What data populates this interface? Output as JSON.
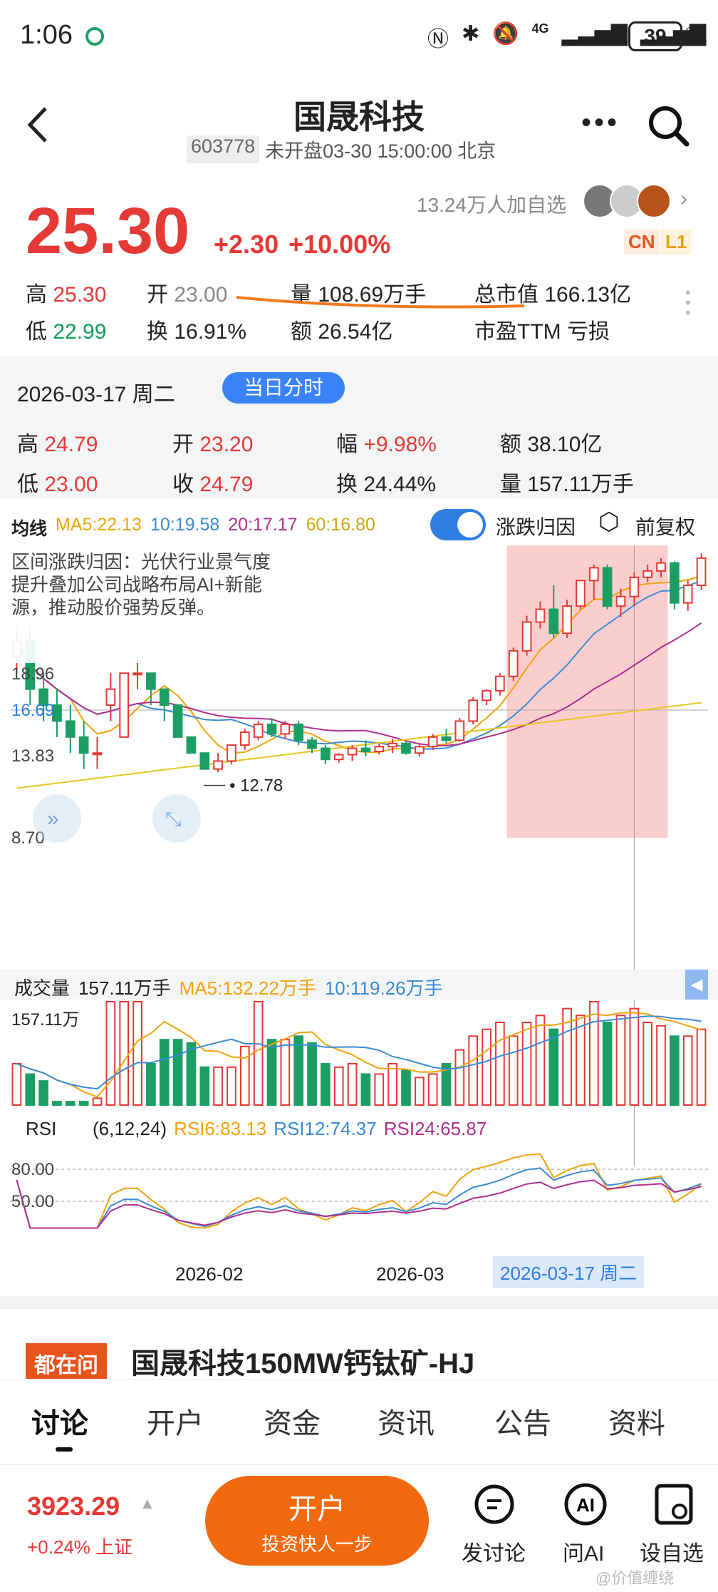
{
  "status": {
    "time": "1:06",
    "battery": "39",
    "net": "4G"
  },
  "header": {
    "title": "国晟科技",
    "code": "603778",
    "status_text": "未开盘03-30 15:00:00 北京"
  },
  "quote": {
    "price": "25.30",
    "change": "+2.30",
    "pct": "+10.00%",
    "followers": "13.24万人加自选",
    "badge_cn": "CN",
    "badge_l1": "L1",
    "high_label": "高",
    "high": "25.30",
    "open_label": "开",
    "open": "23.00",
    "vol_label": "量",
    "vol": "108.69万手",
    "mcap_label": "总市值",
    "mcap": "166.13亿",
    "low_label": "低",
    "low": "22.99",
    "turn_label": "换",
    "turn": "16.91%",
    "amt_label": "额",
    "amt": "26.54亿",
    "pe_label": "市盈TTM",
    "pe": "亏损"
  },
  "day": {
    "date": "2026-03-17 周二",
    "chip": "当日分时",
    "high_label": "高",
    "high": "24.79",
    "open_label": "开",
    "open": "23.20",
    "amp_label": "幅",
    "amp": "+9.98%",
    "amt_label": "额",
    "amt": "38.10亿",
    "low_label": "低",
    "low": "23.00",
    "close_label": "收",
    "close": "24.79",
    "turn_label": "换",
    "turn": "24.44%",
    "vol_label": "量",
    "vol": "157.11万手"
  },
  "ma": {
    "label": "均线",
    "ma5": "MA5:22.13",
    "ma10": "10:19.58",
    "ma20": "20:17.17",
    "ma60": "60:16.80",
    "toggle_label": "涨跌归因",
    "adj_label": "前复权"
  },
  "colors": {
    "up": "#e53935",
    "down": "#1b9e63",
    "ma5": "#f2a20c",
    "ma10": "#3a8bd6",
    "ma20": "#b0308f",
    "ma60": "#e8c51e",
    "accent": "#3b82f6",
    "orange": "#f26a0f"
  },
  "chart_data": {
    "type": "candlestick",
    "attribution": "区间涨跌归因：光伏行业景气度提升叠加公司战略布局AI+新能源，推动股价强势反弹。",
    "y_ticks": [
      "18.96",
      "16.69",
      "13.83",
      "8.70"
    ],
    "low_marker": "12.78",
    "x_ticks": [
      "2026-02",
      "2026-03"
    ],
    "selected_date": "2026-03-17 周二",
    "candles": [
      [
        20,
        22,
        19,
        21
      ],
      [
        21,
        22,
        17,
        18
      ],
      [
        18,
        19,
        16,
        17
      ],
      [
        17,
        18,
        15,
        16
      ],
      [
        16,
        17,
        14,
        15
      ],
      [
        15,
        16,
        13,
        14
      ],
      [
        14,
        15,
        13,
        14
      ],
      [
        17,
        19,
        16,
        18
      ],
      [
        15,
        19,
        15,
        19
      ],
      [
        19,
        20,
        18,
        19
      ],
      [
        19,
        19,
        17,
        18
      ],
      [
        18,
        18,
        16,
        17
      ],
      [
        17,
        17,
        15,
        15
      ],
      [
        15,
        15,
        14,
        14
      ],
      [
        14,
        14,
        13,
        13
      ],
      [
        13,
        14,
        12.8,
        13.5
      ],
      [
        13.5,
        14.5,
        13.3,
        14.5
      ],
      [
        14.5,
        15.5,
        14.2,
        15.3
      ],
      [
        15,
        16,
        14.8,
        15.8
      ],
      [
        15.8,
        16.2,
        15,
        15.2
      ],
      [
        15.2,
        16,
        14.9,
        15.8
      ],
      [
        15.8,
        16,
        14.5,
        14.8
      ],
      [
        14.8,
        15,
        14,
        14.3
      ],
      [
        14.3,
        14.5,
        13.3,
        13.6
      ],
      [
        13.6,
        14,
        13.4,
        13.9
      ],
      [
        13.9,
        14.5,
        13.5,
        14.3
      ],
      [
        14.3,
        14.8,
        13.8,
        14.1
      ],
      [
        14.1,
        14.6,
        13.9,
        14.4
      ],
      [
        14.4,
        14.9,
        14,
        14.6
      ],
      [
        14.6,
        14.7,
        13.9,
        14
      ],
      [
        14,
        14.6,
        13.8,
        14.4
      ],
      [
        14.4,
        15.2,
        14.2,
        15
      ],
      [
        15,
        15.5,
        14.6,
        14.8
      ],
      [
        14.8,
        16.2,
        14.7,
        16
      ],
      [
        16,
        17.5,
        15.8,
        17.3
      ],
      [
        17.3,
        18,
        17,
        17.9
      ],
      [
        17.9,
        19,
        17.6,
        18.8
      ],
      [
        18.8,
        20.6,
        18.5,
        20.4
      ],
      [
        20.4,
        22.6,
        20.1,
        22.2
      ],
      [
        22.2,
        23.5,
        21.8,
        23
      ],
      [
        23,
        24.5,
        21.2,
        21.5
      ],
      [
        21.5,
        23.6,
        21.2,
        23.2
      ],
      [
        23.2,
        24.8,
        23,
        24.8
      ],
      [
        24.8,
        25.8,
        23.6,
        25.6
      ],
      [
        25.6,
        25.8,
        23,
        23.2
      ],
      [
        23.2,
        24.3,
        22.5,
        23.8
      ],
      [
        23.8,
        25.3,
        23.2,
        25
      ],
      [
        25,
        25.8,
        24.7,
        25.4
      ],
      [
        25.4,
        26.2,
        25,
        25.9
      ],
      [
        25.9,
        26,
        23,
        23.4
      ],
      [
        23.4,
        24.8,
        22.9,
        24.5
      ],
      [
        24.5,
        26.5,
        24.2,
        26.2
      ]
    ],
    "volume": {
      "label": "成交量",
      "current": "157.11万手",
      "ma5": "MA5:132.22万手",
      "ma10": "10:119.26万手",
      "axis_max": "157.11万",
      "bars": [
        60,
        45,
        35,
        5,
        5,
        5,
        10,
        150,
        150,
        150,
        60,
        95,
        95,
        90,
        55,
        55,
        55,
        85,
        150,
        95,
        95,
        100,
        90,
        60,
        55,
        60,
        45,
        45,
        60,
        50,
        40,
        45,
        60,
        80,
        100,
        110,
        120,
        100,
        120,
        130,
        110,
        140,
        130,
        150,
        120,
        130,
        140,
        120,
        115,
        100,
        100,
        110
      ]
    },
    "rsi": {
      "label": "RSI",
      "params": "(6,12,24)",
      "rsi6": "RSI6:83.13",
      "rsi12": "RSI12:74.37",
      "rsi24": "RSI24:65.87",
      "levels": [
        "80.00",
        "50.00"
      ]
    }
  },
  "banner": {
    "tag": "都在问",
    "text": "国晟科技150MW钙钛矿-HJ"
  },
  "tabs": [
    "讨论",
    "开户",
    "资金",
    "资讯",
    "公告",
    "资料"
  ],
  "bottom": {
    "index_value": "3923.29",
    "index_change": "+0.24%",
    "index_name": "上证",
    "cta_main": "开户",
    "cta_sub": "投资快人一步",
    "discuss": "发讨论",
    "ai": "问AI",
    "watch": "设自选"
  },
  "watermark": "@价值缠绕"
}
